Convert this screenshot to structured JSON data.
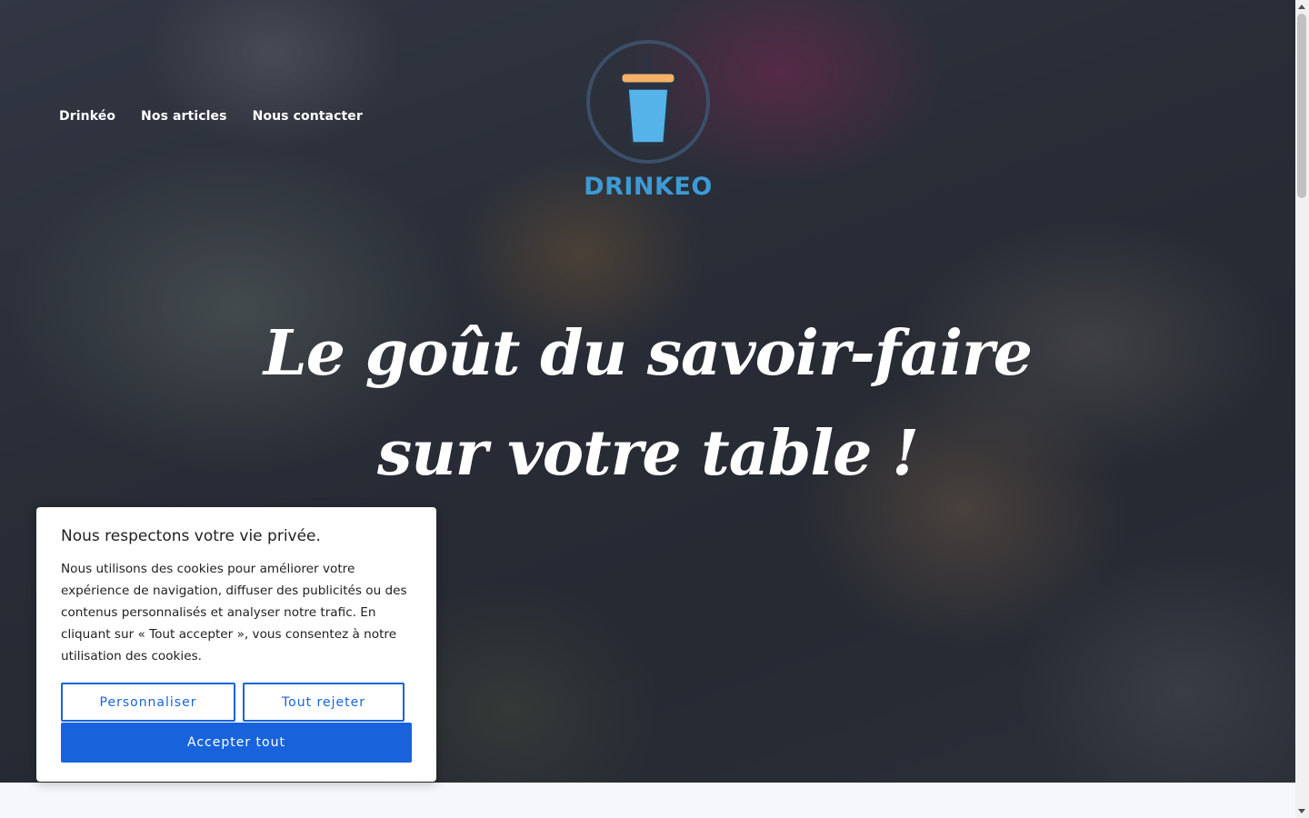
{
  "nav": {
    "items": [
      {
        "label": "Drinkéo"
      },
      {
        "label": "Nos articles"
      },
      {
        "label": "Nous contacter"
      }
    ]
  },
  "logo": {
    "text": "DRINKEO",
    "icon": "cup-with-straw-icon",
    "colors": {
      "ring": "#3c4f68",
      "cup": "#56b3ea",
      "lid": "#f5b168",
      "text": "#3e9ad6"
    }
  },
  "hero": {
    "headline_line1": "Le goût du savoir-faire",
    "headline_line2": "sur votre table !"
  },
  "cookie_banner": {
    "title": "Nous respectons votre vie privée.",
    "text": "Nous utilisons des cookies pour améliorer votre expérience de navigation, diffuser des publicités ou des contenus personnalisés et analyser notre trafic. En cliquant sur « Tout accepter », vous consentez à notre utilisation des cookies.",
    "customize_label": "Personnaliser",
    "reject_label": "Tout rejeter",
    "accept_label": "Accepter tout",
    "accent_color": "#1863dc"
  }
}
